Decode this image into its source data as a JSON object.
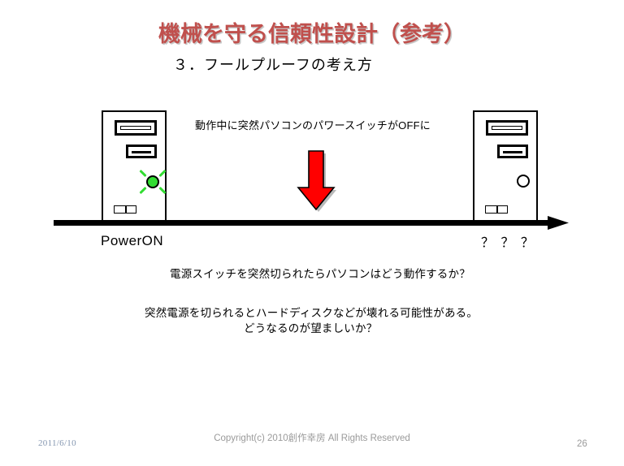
{
  "slide": {
    "title": "機械を守る信頼性設計（参考）",
    "title_color": "#c0504d",
    "subtitle": "３．フールプルーフの考え方"
  },
  "diagram": {
    "switch_off_caption": "動作中に突然パソコンのパワースイッチがOFFに",
    "arrow": {
      "name": "red-down-arrow",
      "fill_color": "#ff0000",
      "stroke_color": "#000000"
    },
    "pc_left": {
      "name": "pc-tower-powered-on",
      "led_state": "on",
      "led_color": "#33dd33"
    },
    "pc_right": {
      "name": "pc-tower-powered-off",
      "led_state": "off",
      "led_color": "#ffffff"
    },
    "timeline": {
      "start_label": "PowerON",
      "end_label": "？ ？ ？",
      "line_color": "#000000"
    }
  },
  "body": {
    "question_line": "電源スイッチを突然切られたらパソコンはどう動作するか？",
    "warning_line_1": "突然電源を切られるとハードディスクなどが壊れる可能性がある。",
    "warning_line_2": "どうなるのが望ましいか？"
  },
  "footer": {
    "date": "2011/6/10",
    "copyright": "Copyright(c)  2010創作幸房 All Rights Reserved",
    "page_number": "26"
  }
}
